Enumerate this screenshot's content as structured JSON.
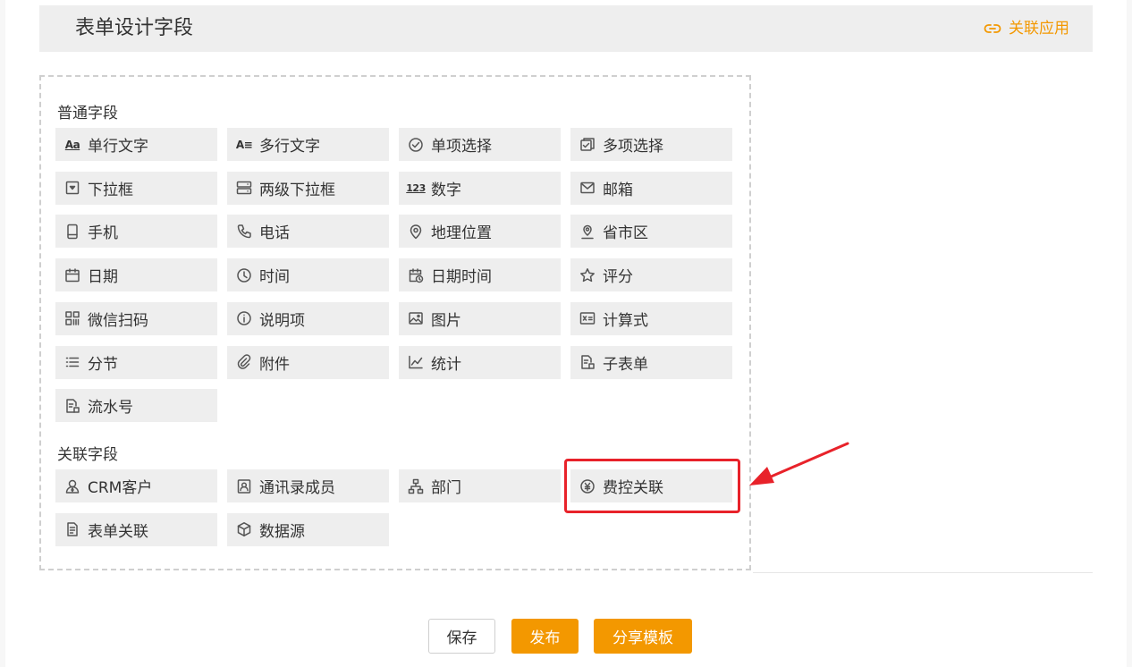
{
  "header": {
    "title": "表单设计字段",
    "link_label": "关联应用"
  },
  "sections": {
    "common_title": "普通字段",
    "related_title": "关联字段"
  },
  "common_fields": [
    {
      "label": "单行文字",
      "icon": "text-aa-icon"
    },
    {
      "label": "多行文字",
      "icon": "multiline-text-icon"
    },
    {
      "label": "单项选择",
      "icon": "radio-check-icon"
    },
    {
      "label": "多项选择",
      "icon": "checkbox-icon"
    },
    {
      "label": "下拉框",
      "icon": "dropdown-icon"
    },
    {
      "label": "两级下拉框",
      "icon": "two-level-dropdown-icon"
    },
    {
      "label": "数字",
      "icon": "number-123-icon"
    },
    {
      "label": "邮箱",
      "icon": "mail-icon"
    },
    {
      "label": "手机",
      "icon": "mobile-icon"
    },
    {
      "label": "电话",
      "icon": "phone-icon"
    },
    {
      "label": "地理位置",
      "icon": "location-pin-icon"
    },
    {
      "label": "省市区",
      "icon": "region-pin-icon"
    },
    {
      "label": "日期",
      "icon": "calendar-icon"
    },
    {
      "label": "时间",
      "icon": "clock-icon"
    },
    {
      "label": "日期时间",
      "icon": "calendar-clock-icon"
    },
    {
      "label": "评分",
      "icon": "star-icon"
    },
    {
      "label": "微信扫码",
      "icon": "qr-code-icon"
    },
    {
      "label": "说明项",
      "icon": "info-icon"
    },
    {
      "label": "图片",
      "icon": "image-icon"
    },
    {
      "label": "计算式",
      "icon": "formula-icon"
    },
    {
      "label": "分节",
      "icon": "section-list-icon"
    },
    {
      "label": "附件",
      "icon": "paperclip-icon"
    },
    {
      "label": "统计",
      "icon": "line-chart-icon"
    },
    {
      "label": "子表单",
      "icon": "subform-icon"
    },
    {
      "label": "流水号",
      "icon": "serial-number-icon"
    }
  ],
  "related_fields": [
    {
      "label": "CRM客户",
      "icon": "customer-icon"
    },
    {
      "label": "通讯录成员",
      "icon": "contact-card-icon"
    },
    {
      "label": "部门",
      "icon": "org-chart-icon"
    },
    {
      "label": "费控关联",
      "icon": "yuan-coin-icon"
    },
    {
      "label": "表单关联",
      "icon": "form-link-icon"
    },
    {
      "label": "数据源",
      "icon": "cube-icon"
    }
  ],
  "buttons": {
    "save": "保存",
    "publish": "发布",
    "share": "分享模板"
  },
  "colors": {
    "accent": "#f39800",
    "highlight": "#e8222a"
  }
}
